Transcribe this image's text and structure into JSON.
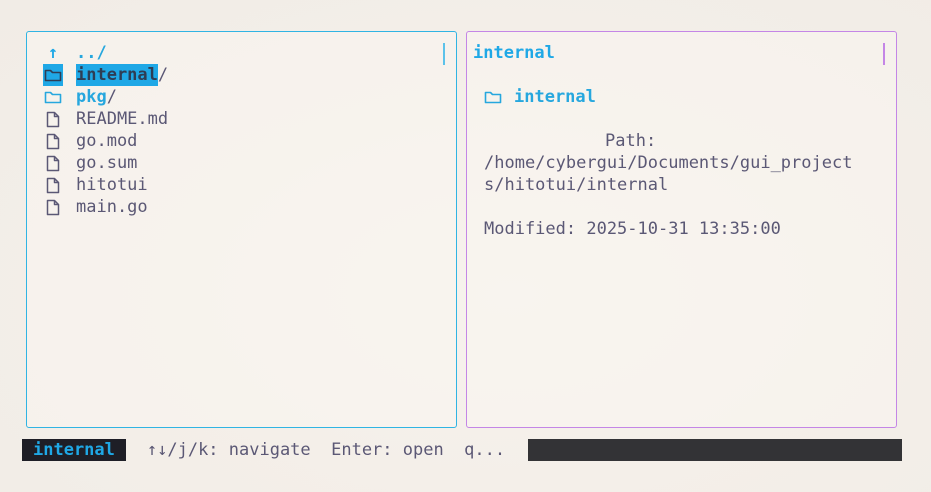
{
  "colors": {
    "accent_blue": "#1fa8e6",
    "left_border": "#30b4e3",
    "right_border": "#c486e6",
    "text": "#5b5875",
    "status_bg": "#1e1e26"
  },
  "file_list": {
    "parent": {
      "icon": "arrow-up-icon",
      "label": "../"
    },
    "items": [
      {
        "name": "internal",
        "suffix": "/",
        "type": "dir",
        "icon": "folder-icon",
        "selected": true
      },
      {
        "name": "pkg",
        "suffix": "/",
        "type": "dir",
        "icon": "folder-icon",
        "selected": false
      },
      {
        "name": "README.md",
        "suffix": "",
        "type": "file",
        "icon": "file-icon",
        "selected": false
      },
      {
        "name": "go.mod",
        "suffix": "",
        "type": "file",
        "icon": "file-icon",
        "selected": false
      },
      {
        "name": "go.sum",
        "suffix": "",
        "type": "file",
        "icon": "file-icon",
        "selected": false
      },
      {
        "name": "hitotui",
        "suffix": "",
        "type": "file",
        "icon": "file-icon",
        "selected": false
      },
      {
        "name": "main.go",
        "suffix": "",
        "type": "file",
        "icon": "file-icon",
        "selected": false
      }
    ]
  },
  "preview": {
    "title": "internal",
    "name": "internal",
    "icon": "folder-icon",
    "path_label": "Path:",
    "path_line1": "/home/cybergui/Documents/gui_project",
    "path_line2": "s/hitotui/internal",
    "modified": "Modified: 2025-10-31 13:35:00"
  },
  "status": {
    "current": "internal",
    "help": "↑↓/j/k: navigate  Enter: open  q..."
  }
}
